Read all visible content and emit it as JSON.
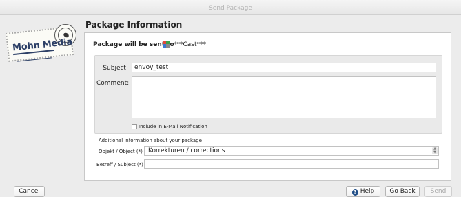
{
  "window": {
    "title": "Send Package"
  },
  "logo": {
    "text": "Mohn Media"
  },
  "panel": {
    "title": "Package Information",
    "sent_to_label": "Package will be sent to",
    "recipient": "***Cast***"
  },
  "form": {
    "subject_label": "Subject:",
    "subject_value": "envoy_test",
    "comment_label": "Comment:",
    "comment_value": "",
    "email_notification_label": "Include in E-Mail Notification",
    "email_notification_checked": false
  },
  "additional": {
    "heading": "Additional information about your package",
    "objekt_label": "Objekt / Object (*)",
    "objekt_value": "Korrekturen / corrections",
    "betreff_label": "Betreff / Subject (*)",
    "betreff_value": ""
  },
  "buttons": {
    "cancel": "Cancel",
    "help": "Help",
    "go_back": "Go Back",
    "send": "Send"
  },
  "icons": {
    "help": "help-icon",
    "recipient": "recipient-icon",
    "select": "select-arrows-icon"
  }
}
